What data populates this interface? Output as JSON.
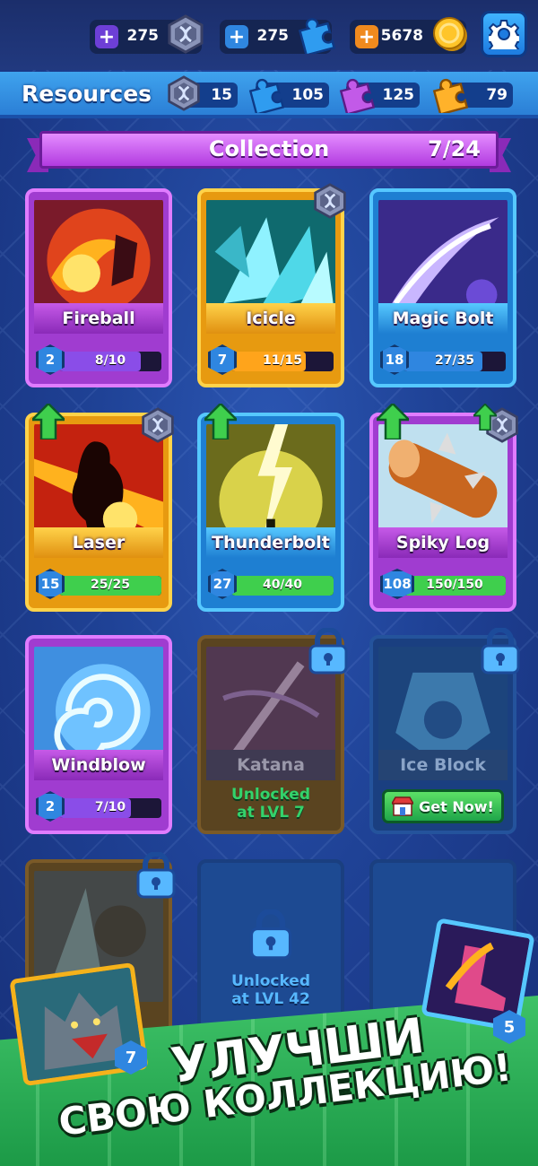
{
  "topbar": {
    "currencies": [
      {
        "amount": "275",
        "icon": "dna-gem-icon",
        "plus_color": "#6d3fd6"
      },
      {
        "amount": "275",
        "icon": "blue-puzzle-icon",
        "plus_color": "#2f86e0"
      },
      {
        "amount": "5678",
        "icon": "gold-coin-icon",
        "plus_color": "#f08a1e"
      }
    ],
    "settings_icon": "gear-icon"
  },
  "resources": {
    "title": "Resources",
    "items": [
      {
        "amount": "15",
        "icon": "dna-gem-icon"
      },
      {
        "amount": "105",
        "icon": "blue-puzzle-icon"
      },
      {
        "amount": "125",
        "icon": "purple-puzzle-icon"
      },
      {
        "amount": "79",
        "icon": "orange-puzzle-icon"
      }
    ]
  },
  "collection": {
    "title": "Collection",
    "count": "7/24"
  },
  "cards": [
    {
      "name": "Fireball",
      "level": "2",
      "progress": "8/10",
      "fill": 0.8,
      "rarity": "epic"
    },
    {
      "name": "Icicle",
      "level": "7",
      "progress": "11/15",
      "fill": 0.73,
      "rarity": "legendary"
    },
    {
      "name": "Magic Bolt",
      "level": "18",
      "progress": "27/35",
      "fill": 0.77,
      "rarity": "rare"
    },
    {
      "name": "Laser",
      "level": "15",
      "progress": "25/25",
      "fill": 1.0,
      "rarity": "legendary"
    },
    {
      "name": "Thunderbolt",
      "level": "27",
      "progress": "40/40",
      "fill": 1.0,
      "rarity": "rare"
    },
    {
      "name": "Spiky Log",
      "level": "108",
      "progress": "150/150",
      "fill": 1.0,
      "rarity": "epic"
    },
    {
      "name": "Windblow",
      "level": "2",
      "progress": "7/10",
      "fill": 0.7,
      "rarity": "epic"
    },
    {
      "name": "Katana",
      "locked_text_1": "Unlocked",
      "locked_text_2": "at LVL 7"
    },
    {
      "name": "Ice Block",
      "cta": "Get Now!"
    },
    {
      "locked_text_1": "Unlocked",
      "locked_text_2": "at LVL 42"
    }
  ],
  "promo": {
    "line1": "УЛУЧШИ",
    "line2": "СВОЮ КОЛЛЕКЦИЮ!",
    "left_card_level": "7",
    "right_card_level": "5"
  },
  "colors": {
    "legendary": "#f5b21b",
    "epic": "#c84de8",
    "rare": "#2fa8ef",
    "progress_purple": "#8a4de8",
    "progress_orange": "#ffa41b",
    "progress_blue": "#2f86e0",
    "progress_green": "#3fcf4d"
  }
}
